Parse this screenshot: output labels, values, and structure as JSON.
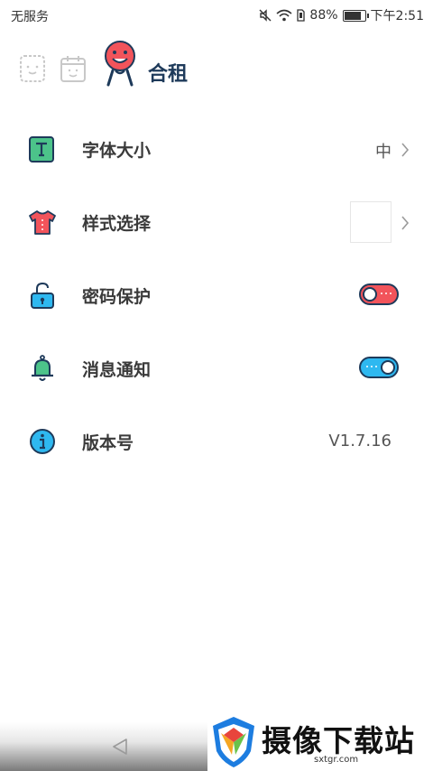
{
  "status_bar": {
    "carrier": "无服务",
    "battery_percent": "88%",
    "battery_level": 0.88,
    "time": "下午2:51",
    "icons": [
      "mute-icon",
      "wifi-icon",
      "sim-icon",
      "battery-icon"
    ]
  },
  "header": {
    "left_icons": [
      "note-icon",
      "calendar-icon"
    ],
    "logo_icon": "mascot-logo-icon",
    "title": "合租"
  },
  "settings": {
    "font_size": {
      "label": "字体大小",
      "value": "中",
      "icon": "text-T-icon"
    },
    "style": {
      "label": "样式选择",
      "icon": "tshirt-icon"
    },
    "password": {
      "label": "密码保护",
      "icon": "padlock-icon",
      "enabled": false
    },
    "notification": {
      "label": "消息通知",
      "icon": "bell-icon",
      "enabled": true
    },
    "version": {
      "label": "版本号",
      "value": "V1.7.16",
      "icon": "info-icon"
    }
  },
  "colors": {
    "accent_dark": "#1e3a5a",
    "toggle_off": "#f2545b",
    "toggle_on": "#2eb8f0",
    "icon_green": "#4cc38a",
    "icon_red": "#f2545b",
    "icon_blue": "#2eb8f0"
  },
  "watermark": {
    "title": "摄像下载站",
    "url": "sxtgr.com"
  }
}
